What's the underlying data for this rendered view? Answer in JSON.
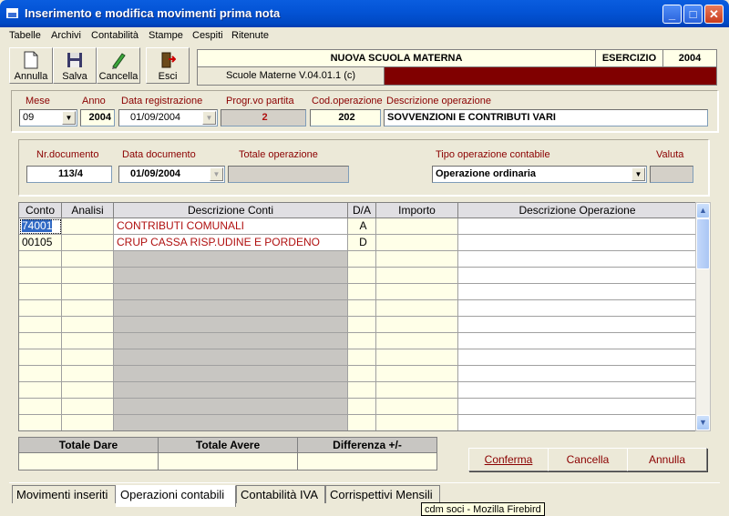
{
  "window": {
    "title": "Inserimento e modifica movimenti prima nota"
  },
  "menus": [
    "Tabelle",
    "Archivi",
    "Contabilità",
    "Stampe",
    "Cespiti",
    "Ritenute"
  ],
  "toolbar": {
    "annulla": "Annulla",
    "salva": "Salva",
    "cancella": "Cancella",
    "esci": "Esci"
  },
  "header": {
    "company": "NUOVA SCUOLA MATERNA",
    "esercizio_label": "ESERCIZIO",
    "esercizio_value": "2004",
    "version": "Scuole Materne V.04.01.1 (c)",
    "version_color": "#800000"
  },
  "top": {
    "mese_label": "Mese",
    "mese": "09",
    "anno_label": "Anno",
    "anno": "2004",
    "data_reg_label": "Data registrazione",
    "data_reg": "01/09/2004",
    "progr_label": "Progr.vo partita",
    "progr": "2",
    "cod_op_label": "Cod.operazione",
    "cod_op": "202",
    "desc_op_label": "Descrizione operazione",
    "desc_op": "SOVVENZIONI E CONTRIBUTI VARI"
  },
  "doc": {
    "nr_doc_label": "Nr.documento",
    "nr_doc": "113/4",
    "data_doc_label": "Data documento",
    "data_doc": "01/09/2004",
    "totale_label": "Totale operazione",
    "totale": "",
    "tipo_label": "Tipo operazione contabile",
    "tipo": "Operazione ordinaria",
    "valuta_label": "Valuta",
    "valuta": ""
  },
  "grid": {
    "columns": [
      "Conto",
      "Analisi",
      "Descrizione Conti",
      "D/A",
      "Importo",
      "Descrizione Operazione"
    ],
    "rows": [
      {
        "conto": "74001",
        "analisi": "",
        "descrizione": "CONTRIBUTI COMUNALI",
        "da": "A",
        "importo": "",
        "desc_op": ""
      },
      {
        "conto": "00105",
        "analisi": "",
        "descrizione": "CRUP CASSA RISP.UDINE E PORDENO",
        "da": "D",
        "importo": "",
        "desc_op": ""
      }
    ]
  },
  "totals": {
    "dare_label": "Totale Dare",
    "avere_label": "Totale Avere",
    "diff_label": "Differenza +/-"
  },
  "buttons": {
    "conferma": "Conferma",
    "cancella": "Cancella",
    "annulla": "Annulla"
  },
  "tabs": [
    "Movimenti inseriti",
    "Operazioni contabili",
    "Contabilità IVA",
    "Corrispettivi Mensili"
  ],
  "tooltip": "cdm soci - Mozilla Firebird"
}
